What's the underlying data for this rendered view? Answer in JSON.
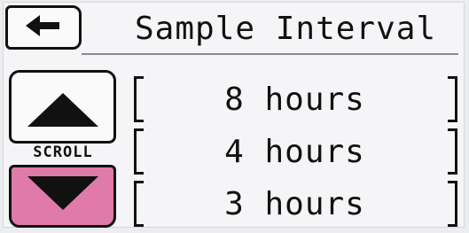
{
  "header": {
    "title": "Sample Interval",
    "back_icon": "arrow-left-icon"
  },
  "scroll": {
    "label": "SCROLL",
    "up_icon": "triangle-up-icon",
    "down_icon": "triangle-down-icon",
    "down_color": "#e07aa9"
  },
  "options": [
    {
      "label": "8 hours"
    },
    {
      "label": "4 hours"
    },
    {
      "label": "3 hours"
    }
  ]
}
